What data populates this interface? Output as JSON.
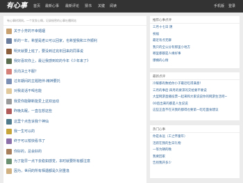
{
  "app": {
    "logo": "有心事"
  },
  "nav": {
    "items": [
      "首页",
      "最新心事",
      "最新评论",
      "猜书",
      "关键",
      "阅读"
    ],
    "right": [
      "手机版",
      "登录"
    ]
  },
  "main": {
    "intro": "有心事树洞网，一个发发心情，记录秘密的心事吐槽网站",
    "posts": [
      {
        "title": "关于小芳的不幸婚姻",
        "avatar_color": "#c8a070"
      },
      {
        "title": "新的一年，希望是老公可以回家，也希望我和工作顺利",
        "avatar_color": "#6a7d9c"
      },
      {
        "title": "明天就要上班了，要没到过完年回来的同事说",
        "avatar_color": "#8b5e3c"
      },
      {
        "title": "我好喜欢你上，最让我感到欢的今年《少年来了》",
        "avatar_color": "#5a6e4f"
      },
      {
        "title": "反向决土不服？",
        "avatar_color": "#d6807a"
      },
      {
        "title": "过年期间的主题陪伴-精神要托",
        "avatar_color": "#7a8fb3"
      },
      {
        "title": "对我说话不喝也能",
        "avatar_color": "#e0c89a"
      },
      {
        "title": "我爱你能聊新能爱上这双运动",
        "avatar_color": "#9a9a9a"
      },
      {
        "title": "昨晚失眠，一直在想这些",
        "avatar_color": "#b05a5a"
      },
      {
        "title": "这里个点告诉我个神仙",
        "avatar_color": "#4f7a8c"
      },
      {
        "title": "我一生可以的",
        "avatar_color": "#c7a53a"
      },
      {
        "title": "终于可以愉快看书了",
        "avatar_color": "#8c6fa8"
      },
      {
        "title": "你好的，总会好的",
        "avatar_color": "#a87f5c"
      },
      {
        "title": "为了能早一点下去稳如感觉，本时就要所有都注意",
        "avatar_color": "#6b8f71"
      },
      {
        "title": "因为，世间的所有相遇都是久别重逢",
        "avatar_color": "#d0b080"
      }
    ]
  },
  "sidebar": {
    "boxes": [
      {
        "heading": "推荐心事点评",
        "links": [
          "三月十七日 阴",
          "祝福",
          "最近有点无聊",
          "我只的全公分有那里小地方",
          "哪里都都是人缘好事",
          "爆棚的心情"
        ]
      },
      {
        "heading": "最新点评",
        "links": [
          "冷暖都有数给你小子最近吃得满意！",
          "三月的事后 四月的要求的交给要不要说",
          "大型网游直播投票一起来和大家说说你的网游生活吧~",
          "00后出来的都是人生说说",
          "这些正直不在天我的都得也要第一吃吃面食建议"
        ]
      },
      {
        "heading": "热门心事",
        "links": [
          "你是永远（工之怀童年）",
          "活跃在我的生日礼物",
          "一等为朝的晚",
          "我要回家",
          "告别我开多少"
        ]
      }
    ]
  }
}
